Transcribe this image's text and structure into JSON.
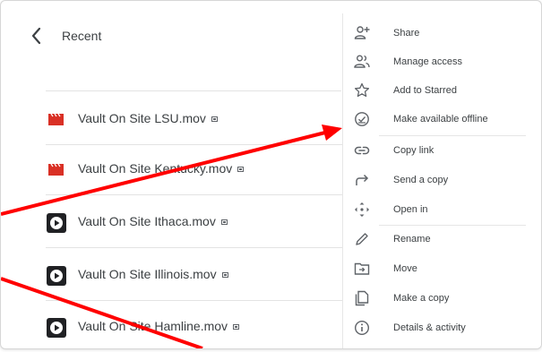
{
  "header": {
    "title": "Recent"
  },
  "files": [
    {
      "name": "Vault On Site LSU.mov",
      "icon": "video-clapper-icon"
    },
    {
      "name": "Vault On Site Kentucky.mov",
      "icon": "video-clapper-icon"
    },
    {
      "name": "Vault On Site Ithaca.mov",
      "icon": "video-play-icon"
    },
    {
      "name": "Vault On Site Illinois.mov",
      "icon": "video-play-icon"
    },
    {
      "name": "Vault On Site Hamline.mov",
      "icon": "video-play-icon"
    }
  ],
  "menu": {
    "items": [
      {
        "label": "Share",
        "icon": "person-add-icon"
      },
      {
        "label": "Manage access",
        "icon": "people-icon"
      },
      {
        "label": "Add to Starred",
        "icon": "star-icon"
      },
      {
        "label": "Make available offline",
        "icon": "offline-check-icon"
      },
      {
        "label": "Copy link",
        "icon": "link-icon"
      },
      {
        "label": "Send a copy",
        "icon": "share-arrow-icon"
      },
      {
        "label": "Open in",
        "icon": "open-in-icon"
      },
      {
        "label": "Rename",
        "icon": "pencil-icon"
      },
      {
        "label": "Move",
        "icon": "move-folder-icon"
      },
      {
        "label": "Make a copy",
        "icon": "copy-icon"
      },
      {
        "label": "Details & activity",
        "icon": "info-icon"
      }
    ]
  },
  "colors": {
    "clapper_red": "#d93025",
    "text": "#3c4043",
    "annotation_red": "#ff0000"
  }
}
